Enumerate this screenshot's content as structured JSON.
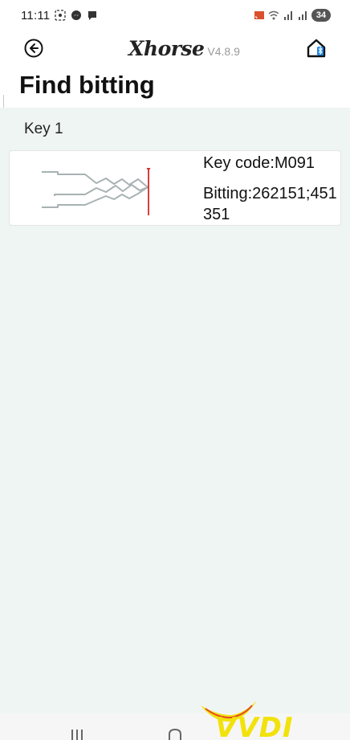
{
  "status_bar": {
    "time": "11:11",
    "battery": "34"
  },
  "header": {
    "brand": "Xhorse",
    "version": "V4.8.9"
  },
  "page": {
    "title": "Find bitting"
  },
  "results": {
    "group_label": "Key 1",
    "key": {
      "code": "Key code:M091",
      "bitting": "Bitting:262151;451351"
    }
  },
  "watermark": {
    "text": "VVDI"
  },
  "colors": {
    "content_bg": "#eff5f3",
    "cut_line": "#d42a2a",
    "key_outline": "#a9b2b2",
    "watermark": "#f2e20c"
  }
}
